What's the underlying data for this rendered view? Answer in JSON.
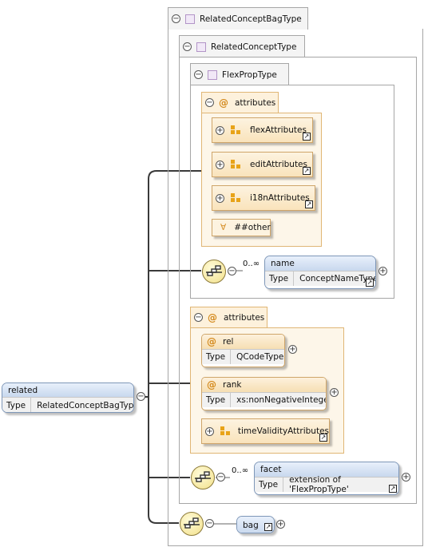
{
  "outer": {
    "label": "RelatedConceptBagType"
  },
  "related_concept": {
    "label": "RelatedConceptType"
  },
  "flexprop": {
    "label": "FlexPropType"
  },
  "attr_group1": {
    "label": "attributes",
    "items": [
      "flexAttributes",
      "editAttributes",
      "i18nAttributes"
    ],
    "wildcard": "##other"
  },
  "name_elem": {
    "label": "name",
    "type_key": "Type",
    "type_val": "ConceptNameType",
    "card": "0..∞"
  },
  "attr_group2": {
    "label": "attributes",
    "rel": {
      "label": "rel",
      "type_key": "Type",
      "type_val": "QCodeType"
    },
    "rank": {
      "label": "rank",
      "type_key": "Type",
      "type_val": "xs:nonNegativeInteger"
    },
    "group": "timeValidityAttributes"
  },
  "facet_elem": {
    "label": "facet",
    "type_key": "Type",
    "type_val": "extension of 'FlexPropType'",
    "card": "0..∞"
  },
  "bag_elem": {
    "label": "bag"
  },
  "root": {
    "label": "related",
    "type_key": "Type",
    "type_val": "RelatedConceptBagType"
  }
}
